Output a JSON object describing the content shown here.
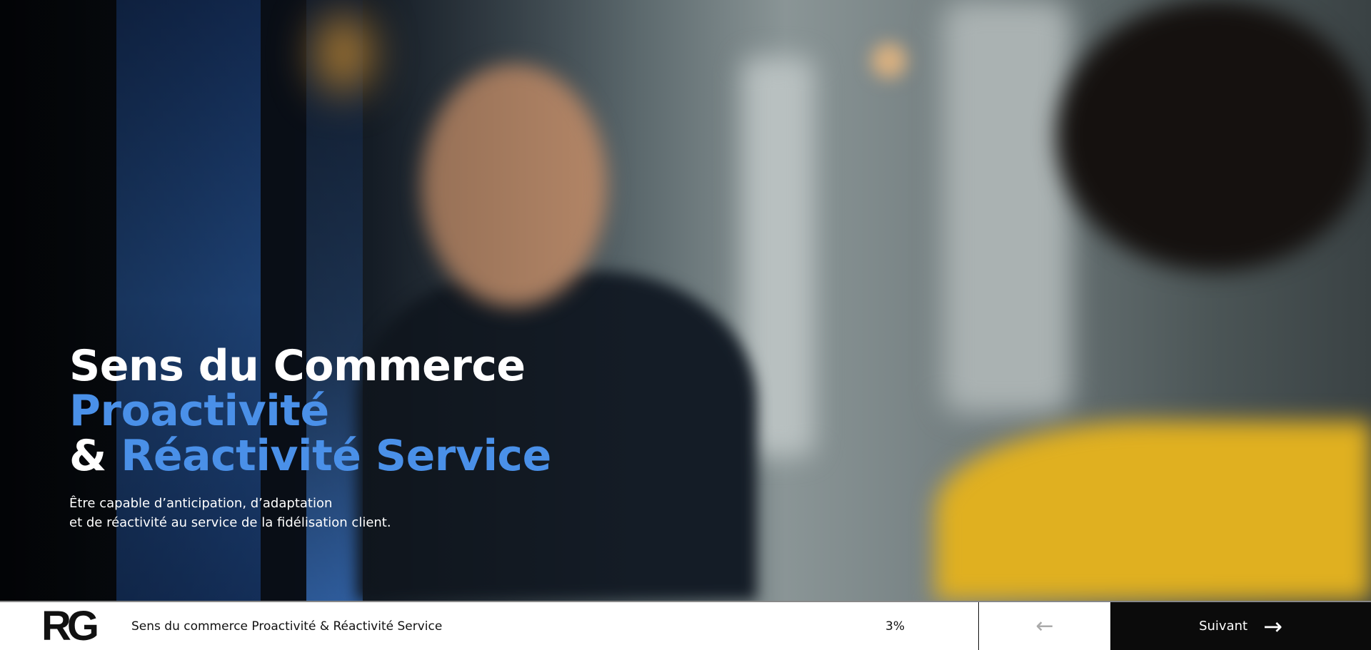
{
  "hero": {
    "title_line1": "Sens du Commerce",
    "title_line2": "Proactivité",
    "title_amp": "&",
    "title_line3": "Réactivité Service",
    "subtitle_line1": "Être capable d’anticipation, d’adaptation",
    "subtitle_line2": "et de réactivité au service de la fidélisation client.",
    "accent_color": "#4a90e8"
  },
  "footer": {
    "logo": "RG",
    "course_title": "Sens du commerce Proactivité & Réactivité Service",
    "progress": "3%",
    "prev_icon": "arrow-left-icon",
    "next_label": "Suivant",
    "next_icon": "arrow-right-icon"
  }
}
